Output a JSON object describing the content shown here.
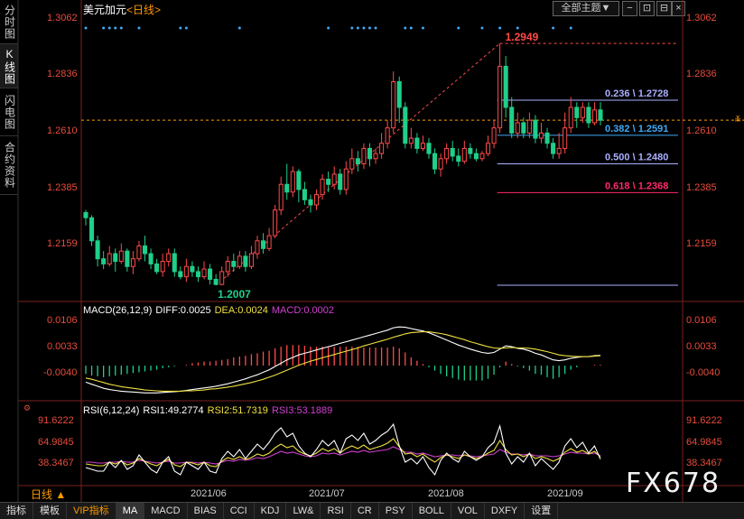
{
  "side_tabs": [
    "分时图",
    "K线图",
    "闪电图",
    "合约资料"
  ],
  "header": {
    "symbol": "美元加元",
    "timeframe": "<日线>",
    "theme_button": "全部主题▼"
  },
  "watermark": "FX678",
  "period_selector": "日线 ▲",
  "price_axis": {
    "labels": [
      "1.3062",
      "1.2836",
      "1.2610",
      "1.2385",
      "1.2159"
    ],
    "current_marker": "≚"
  },
  "dates": [
    "2021/06",
    "2021/07",
    "2021/08",
    "2021/09"
  ],
  "macd": {
    "title": "MACD(26,12,9)",
    "diff": "DIFF:0.0025",
    "dea": "DEA:0.0024",
    "macd": "MACD:0.0002",
    "axis": [
      "0.0106",
      "0.0033",
      "-0.0040"
    ]
  },
  "rsi": {
    "title": "RSI(6,12,24)",
    "rsi1": "RSI1:49.2774",
    "rsi2": "RSI2:51.7319",
    "rsi3": "RSI3:53.1889",
    "axis": [
      "91.6222",
      "64.9845",
      "38.3467"
    ]
  },
  "bottom_tabs": [
    "指标",
    "模板",
    "VIP指标",
    "MA",
    "MACD",
    "BIAS",
    "CCI",
    "KDJ",
    "LW&",
    "RSI",
    "CR",
    "PSY",
    "BOLL",
    "VOL",
    "DXFY",
    "设置"
  ],
  "colors": {
    "up": "#ff4a4a",
    "down": "#1fcf8a",
    "diff": "#ffffff",
    "dea": "#f0e040",
    "rsi3": "#d040d0"
  },
  "chart_data": {
    "type": "candlestick",
    "symbol": "美元加元",
    "timeframe": "日线",
    "ylim": [
      1.2007,
      1.3062
    ],
    "high_label": "1.2949",
    "low_label": "1.2007",
    "fibonacci": [
      {
        "label": "0.236 \\ 1.2728",
        "value": 1.2728,
        "color": "#aab0ff"
      },
      {
        "label": "0.382 \\ 1.2591",
        "value": 1.2591,
        "color": "#3fa9f5"
      },
      {
        "label": "0.500 \\ 1.2480",
        "value": 1.248,
        "color": "#aab0ff"
      },
      {
        "label": "0.618 \\ 1.2368",
        "value": 1.2368,
        "color": "#ff2a6a"
      }
    ],
    "candles": [
      [
        1.229,
        1.227,
        1.23,
        1.224
      ],
      [
        1.227,
        1.218,
        1.228,
        1.216
      ],
      [
        1.218,
        1.211,
        1.22,
        1.208
      ],
      [
        1.211,
        1.209,
        1.214,
        1.207
      ],
      [
        1.209,
        1.213,
        1.216,
        1.208
      ],
      [
        1.213,
        1.21,
        1.215,
        1.206
      ],
      [
        1.21,
        1.214,
        1.217,
        1.209
      ],
      [
        1.214,
        1.208,
        1.215,
        1.206
      ],
      [
        1.208,
        1.211,
        1.214,
        1.205
      ],
      [
        1.211,
        1.216,
        1.218,
        1.21
      ],
      [
        1.216,
        1.213,
        1.22,
        1.21
      ],
      [
        1.213,
        1.209,
        1.215,
        1.207
      ],
      [
        1.209,
        1.206,
        1.211,
        1.205
      ],
      [
        1.206,
        1.21,
        1.213,
        1.204
      ],
      [
        1.21,
        1.213,
        1.215,
        1.208
      ],
      [
        1.213,
        1.206,
        1.215,
        1.204
      ],
      [
        1.206,
        1.204,
        1.208,
        1.203
      ],
      [
        1.204,
        1.208,
        1.211,
        1.202
      ],
      [
        1.208,
        1.206,
        1.21,
        1.204
      ],
      [
        1.206,
        1.204,
        1.208,
        1.202
      ],
      [
        1.204,
        1.207,
        1.21,
        1.203
      ],
      [
        1.207,
        1.203,
        1.209,
        1.201
      ],
      [
        1.203,
        1.201,
        1.205,
        1.2007
      ],
      [
        1.201,
        1.206,
        1.208,
        1.2007
      ],
      [
        1.206,
        1.21,
        1.212,
        1.204
      ],
      [
        1.21,
        1.208,
        1.213,
        1.206
      ],
      [
        1.208,
        1.212,
        1.214,
        1.207
      ],
      [
        1.212,
        1.208,
        1.214,
        1.206
      ],
      [
        1.208,
        1.213,
        1.216,
        1.207
      ],
      [
        1.213,
        1.218,
        1.22,
        1.211
      ],
      [
        1.218,
        1.215,
        1.221,
        1.213
      ],
      [
        1.215,
        1.22,
        1.223,
        1.214
      ],
      [
        1.22,
        1.23,
        1.232,
        1.219
      ],
      [
        1.23,
        1.24,
        1.243,
        1.228
      ],
      [
        1.24,
        1.237,
        1.248,
        1.234
      ],
      [
        1.237,
        1.245,
        1.247,
        1.235
      ],
      [
        1.245,
        1.238,
        1.246,
        1.233
      ],
      [
        1.238,
        1.234,
        1.241,
        1.232
      ],
      [
        1.234,
        1.232,
        1.236,
        1.229
      ],
      [
        1.232,
        1.236,
        1.238,
        1.23
      ],
      [
        1.236,
        1.242,
        1.244,
        1.234
      ],
      [
        1.242,
        1.24,
        1.245,
        1.237
      ],
      [
        1.24,
        1.244,
        1.247,
        1.238
      ],
      [
        1.244,
        1.238,
        1.246,
        1.236
      ],
      [
        1.238,
        1.246,
        1.249,
        1.236
      ],
      [
        1.246,
        1.25,
        1.254,
        1.244
      ],
      [
        1.25,
        1.248,
        1.253,
        1.245
      ],
      [
        1.248,
        1.254,
        1.256,
        1.246
      ],
      [
        1.254,
        1.25,
        1.256,
        1.247
      ],
      [
        1.25,
        1.252,
        1.254,
        1.248
      ],
      [
        1.252,
        1.256,
        1.26,
        1.25
      ],
      [
        1.256,
        1.262,
        1.265,
        1.254
      ],
      [
        1.262,
        1.28,
        1.284,
        1.26
      ],
      [
        1.28,
        1.27,
        1.282,
        1.264
      ],
      [
        1.27,
        1.256,
        1.272,
        1.254
      ],
      [
        1.256,
        1.258,
        1.262,
        1.254
      ],
      [
        1.258,
        1.254,
        1.26,
        1.252
      ],
      [
        1.254,
        1.256,
        1.259,
        1.253
      ],
      [
        1.256,
        1.252,
        1.258,
        1.25
      ],
      [
        1.252,
        1.246,
        1.254,
        1.244
      ],
      [
        1.246,
        1.25,
        1.252,
        1.243
      ],
      [
        1.25,
        1.254,
        1.256,
        1.248
      ],
      [
        1.254,
        1.251,
        1.257,
        1.249
      ],
      [
        1.251,
        1.249,
        1.254,
        1.247
      ],
      [
        1.249,
        1.254,
        1.257,
        1.248
      ],
      [
        1.254,
        1.252,
        1.256,
        1.25
      ],
      [
        1.252,
        1.25,
        1.254,
        1.249
      ],
      [
        1.25,
        1.252,
        1.253,
        1.249
      ],
      [
        1.252,
        1.256,
        1.259,
        1.251
      ],
      [
        1.256,
        1.262,
        1.265,
        1.254
      ],
      [
        1.262,
        1.286,
        1.2949,
        1.26
      ],
      [
        1.286,
        1.27,
        1.29,
        1.266
      ],
      [
        1.27,
        1.26,
        1.274,
        1.258
      ],
      [
        1.26,
        1.264,
        1.268,
        1.258
      ],
      [
        1.264,
        1.26,
        1.266,
        1.258
      ],
      [
        1.26,
        1.265,
        1.268,
        1.258
      ],
      [
        1.265,
        1.258,
        1.267,
        1.256
      ],
      [
        1.258,
        1.26,
        1.264,
        1.256
      ],
      [
        1.26,
        1.256,
        1.262,
        1.254
      ],
      [
        1.256,
        1.252,
        1.258,
        1.25
      ],
      [
        1.252,
        1.254,
        1.26,
        1.25
      ],
      [
        1.254,
        1.262,
        1.268,
        1.252
      ],
      [
        1.262,
        1.27,
        1.274,
        1.26
      ],
      [
        1.27,
        1.266,
        1.272,
        1.262
      ],
      [
        1.266,
        1.27,
        1.272,
        1.264
      ],
      [
        1.27,
        1.264,
        1.272,
        1.262
      ],
      [
        1.264,
        1.269,
        1.272,
        1.263
      ],
      [
        1.269,
        1.265,
        1.272,
        1.263
      ]
    ],
    "macd": {
      "ylim": [
        -0.0072,
        0.0125
      ],
      "diff": [
        -0.004,
        -0.0045,
        -0.005,
        -0.0055,
        -0.0058,
        -0.006,
        -0.0062,
        -0.0063,
        -0.0064,
        -0.0065,
        -0.0066,
        -0.0066,
        -0.0066,
        -0.0065,
        -0.0064,
        -0.0063,
        -0.0062,
        -0.006,
        -0.0058,
        -0.0056,
        -0.0054,
        -0.0052,
        -0.005,
        -0.0047,
        -0.0044,
        -0.004,
        -0.0036,
        -0.0032,
        -0.0027,
        -0.0022,
        -0.0016,
        -0.001,
        -0.0002,
        0.0006,
        0.0014,
        0.002,
        0.0026,
        0.003,
        0.0034,
        0.0038,
        0.0042,
        0.0046,
        0.005,
        0.0054,
        0.0058,
        0.0062,
        0.0066,
        0.007,
        0.0074,
        0.0078,
        0.0082,
        0.0086,
        0.0092,
        0.0094,
        0.0093,
        0.009,
        0.0087,
        0.0084,
        0.008,
        0.0074,
        0.0068,
        0.0062,
        0.0056,
        0.005,
        0.0045,
        0.004,
        0.0036,
        0.0032,
        0.003,
        0.0032,
        0.004,
        0.0048,
        0.0046,
        0.0042,
        0.004,
        0.0036,
        0.003,
        0.0026,
        0.002,
        0.0014,
        0.0012,
        0.0014,
        0.0018,
        0.002,
        0.0022,
        0.0022,
        0.0024,
        0.0025
      ],
      "dea": [
        -0.003,
        -0.0033,
        -0.0037,
        -0.0041,
        -0.0045,
        -0.0048,
        -0.0051,
        -0.0053,
        -0.0055,
        -0.0057,
        -0.0059,
        -0.006,
        -0.0061,
        -0.0062,
        -0.0062,
        -0.0062,
        -0.0062,
        -0.0061,
        -0.0061,
        -0.006,
        -0.0059,
        -0.0057,
        -0.0056,
        -0.0054,
        -0.0052,
        -0.005,
        -0.0047,
        -0.0044,
        -0.0041,
        -0.0037,
        -0.0033,
        -0.0028,
        -0.0023,
        -0.0017,
        -0.0011,
        -0.0005,
        0.0001,
        0.0006,
        0.0011,
        0.0015,
        0.0019,
        0.0023,
        0.0027,
        0.0031,
        0.0035,
        0.0039,
        0.0043,
        0.0048,
        0.0052,
        0.0056,
        0.006,
        0.0064,
        0.0069,
        0.0073,
        0.0077,
        0.008,
        0.0081,
        0.0082,
        0.0082,
        0.008,
        0.0078,
        0.0075,
        0.0071,
        0.0067,
        0.0063,
        0.0058,
        0.0054,
        0.005,
        0.0046,
        0.0043,
        0.0042,
        0.0043,
        0.0044,
        0.0043,
        0.0043,
        0.0042,
        0.004,
        0.0037,
        0.0034,
        0.003,
        0.0026,
        0.0024,
        0.0023,
        0.0022,
        0.0022,
        0.0022,
        0.0023,
        0.0024
      ]
    },
    "rsi": {
      "ylim": [
        26,
        100
      ],
      "rsi1": [
        40,
        38,
        36,
        36,
        46,
        40,
        48,
        38,
        42,
        54,
        46,
        38,
        34,
        46,
        52,
        36,
        32,
        46,
        42,
        38,
        46,
        36,
        34,
        50,
        58,
        52,
        60,
        50,
        58,
        66,
        60,
        68,
        78,
        84,
        74,
        78,
        64,
        56,
        52,
        60,
        70,
        64,
        70,
        56,
        72,
        76,
        70,
        78,
        66,
        70,
        76,
        80,
        88,
        64,
        46,
        50,
        44,
        52,
        40,
        32,
        48,
        56,
        50,
        46,
        58,
        52,
        48,
        52,
        62,
        68,
        86,
        56,
        44,
        52,
        46,
        56,
        42,
        50,
        44,
        38,
        46,
        64,
        72,
        62,
        68,
        56,
        64,
        49.2774
      ],
      "rsi2": [
        44,
        43,
        42,
        42,
        46,
        44,
        47,
        43,
        45,
        50,
        47,
        44,
        42,
        46,
        49,
        43,
        41,
        46,
        45,
        43,
        46,
        42,
        41,
        47,
        51,
        49,
        52,
        49,
        51,
        55,
        53,
        56,
        62,
        66,
        62,
        64,
        58,
        55,
        53,
        56,
        61,
        58,
        61,
        56,
        61,
        64,
        61,
        65,
        60,
        62,
        64,
        67,
        72,
        63,
        55,
        56,
        52,
        55,
        50,
        46,
        51,
        54,
        52,
        50,
        54,
        52,
        50,
        52,
        56,
        59,
        70,
        60,
        54,
        55,
        52,
        55,
        50,
        52,
        50,
        47,
        50,
        57,
        61,
        57,
        59,
        55,
        58,
        51.7319
      ],
      "rsi3": [
        46,
        46,
        45,
        45,
        46,
        46,
        47,
        46,
        46,
        48,
        47,
        46,
        45,
        46,
        47,
        45,
        45,
        46,
        46,
        45,
        46,
        45,
        44,
        46,
        48,
        47,
        49,
        48,
        49,
        51,
        50,
        52,
        55,
        58,
        56,
        57,
        55,
        53,
        52,
        53,
        56,
        55,
        56,
        54,
        56,
        58,
        57,
        59,
        57,
        58,
        59,
        60,
        63,
        60,
        57,
        57,
        55,
        56,
        54,
        52,
        53,
        54,
        54,
        53,
        54,
        53,
        52,
        53,
        54,
        55,
        60,
        57,
        55,
        55,
        54,
        55,
        53,
        53,
        53,
        52,
        53,
        55,
        57,
        56,
        56,
        55,
        56,
        53.1889
      ]
    }
  }
}
